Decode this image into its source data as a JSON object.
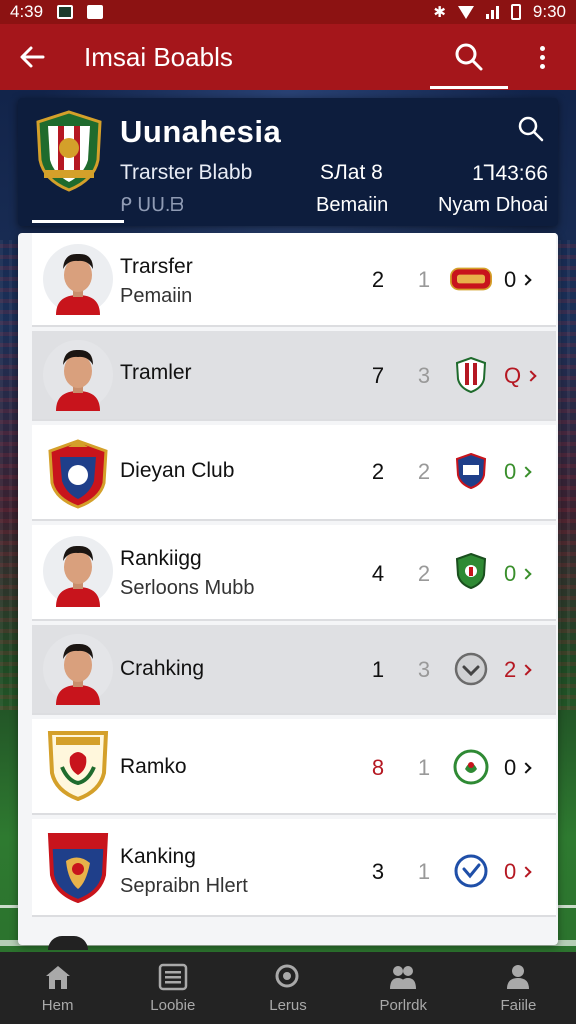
{
  "status_bar": {
    "time": "4:39",
    "clock_right": "9:30",
    "colors": {
      "bg": "#8c1212"
    }
  },
  "app_bar": {
    "title": "Imsai Boabls",
    "icons": [
      "back-arrow-icon",
      "search-icon",
      "more-vert-icon"
    ],
    "colors": {
      "bg": "#a5161b"
    }
  },
  "header": {
    "title": "Uunahesia",
    "sub1": "Trarster Blabb",
    "sub2": "ᑭ ᑌᑌ.ᗷ",
    "mid1": "SЛat 8",
    "mid2": "Bemaiin",
    "right1": "1Ꞁ43:66",
    "right2": "Nyam Dhoai",
    "colors": {
      "bg": "#0d1d3d"
    }
  },
  "rows": [
    {
      "name": "Trarsfer",
      "sub": "Pemaiin",
      "n1": "2",
      "n2": "1",
      "badge": "oval-badge-icon",
      "score": "0",
      "score_color": "dark"
    },
    {
      "name": "Tramler",
      "sub": "",
      "n1": "7",
      "n2": "3",
      "badge": "club-crest-icon",
      "score": "Q",
      "score_color": "red",
      "highlight": true
    },
    {
      "name": "Dieyan Club",
      "sub": "",
      "n1": "2",
      "n2": "2",
      "badge": "shield-crest-icon",
      "score": "0",
      "score_color": "green"
    },
    {
      "name": "Rankiigg",
      "sub": "Serloons Mubb",
      "n1": "4",
      "n2": "2",
      "badge": "green-shield-icon",
      "score": "0",
      "score_color": "green"
    },
    {
      "name": "Crahking",
      "sub": "",
      "n1": "1",
      "n2": "3",
      "badge": "check-circle-icon",
      "score": "2",
      "score_color": "red",
      "highlight": true
    },
    {
      "name": "Ramko",
      "sub": "",
      "n1": "8",
      "n1_color": "red",
      "n2": "1",
      "badge": "green-round-crest-icon",
      "score": "0",
      "score_color": "dark"
    },
    {
      "name": "Kanking",
      "sub": "Sepraibn Hlert",
      "n1": "3",
      "n2": "1",
      "badge": "blue-check-circle-icon",
      "score": "0",
      "score_color": "red"
    }
  ],
  "bottom_nav": [
    {
      "label": "Hem",
      "icon": "home-icon"
    },
    {
      "label": "Loobie",
      "icon": "list-icon"
    },
    {
      "label": "Lerus",
      "icon": "search-icon"
    },
    {
      "label": "Porlrdk",
      "icon": "people-icon"
    },
    {
      "label": "Faiile",
      "icon": "profile-icon"
    }
  ],
  "colors": {
    "accent_green": "#3a8f2c",
    "accent_red": "#b51822",
    "nav_bg": "#232323"
  }
}
